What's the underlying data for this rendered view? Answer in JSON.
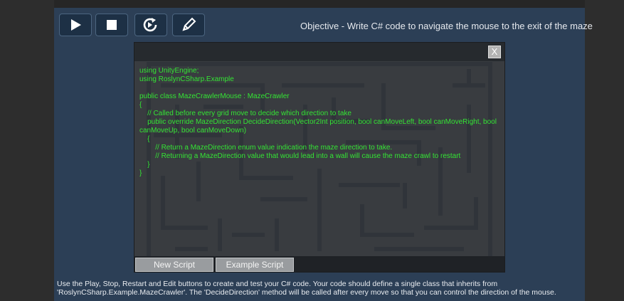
{
  "toolbar": {
    "play": {
      "icon": "play-icon"
    },
    "stop": {
      "icon": "stop-icon"
    },
    "restart": {
      "icon": "restart-icon"
    },
    "edit": {
      "icon": "pencil-icon"
    }
  },
  "objective": "Objective - Write C# code to navigate the mouse to the exit of the maze",
  "editor": {
    "close_label": "X",
    "code": "using UnityEngine;\nusing RoslynCSharp.Example\n\npublic class MazeCrawlerMouse : MazeCrawler\n{\n    // Called before every grid move to decide which direction to take\n    public override MazeDirection DecideDirection(Vector2Int position, bool canMoveLeft, bool canMoveRight, bool canMoveUp, bool canMoveDown)\n    {\n        // Return a MazeDirection enum value indication the maze direction to take.\n        // Returning a MazeDirection value that would lead into a wall will cause the maze crawl to restart\n    }\n}",
    "new_script_label": "New Script",
    "example_script_label": "Example Script"
  },
  "instructions": "Use the Play, Stop, Restart and Edit buttons to create and test your C# code. Your code should define a single class that inherits from 'RoslynCSharp.Example.MazeCrawler'. The 'DecideDirection' method will be called after every move so that you can control the direction of the mouse.",
  "colors": {
    "panel": "#2c3f56",
    "code_text": "#34e434",
    "editor_bg": "#393c40"
  }
}
